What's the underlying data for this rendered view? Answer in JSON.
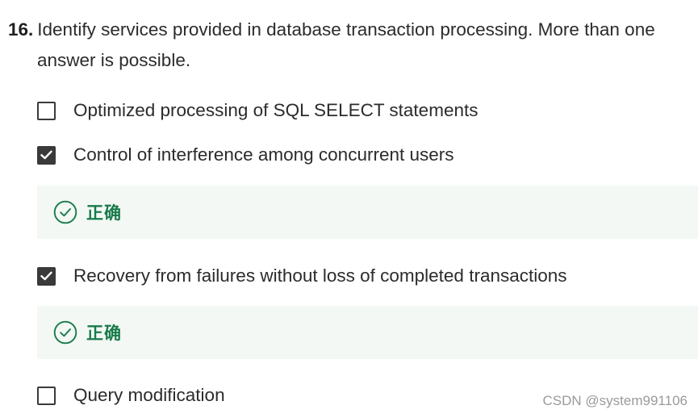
{
  "question": {
    "number": "16.",
    "text_line1": "Identify services provided in database transaction processing. More than one",
    "text_line2": "answer is possible."
  },
  "options": [
    {
      "label": "Optimized processing of SQL SELECT statements",
      "checked": false
    },
    {
      "label": "Control of interference among concurrent users",
      "checked": true,
      "feedback": "正确"
    },
    {
      "label": "Recovery from failures without loss of completed transactions",
      "checked": true,
      "feedback": "正确"
    },
    {
      "label": "Query modification",
      "checked": false
    }
  ],
  "icons": {
    "checkbox_checked": "check-icon",
    "feedback": "check-circle-icon"
  },
  "colors": {
    "correct_text": "#1a7a4a",
    "feedback_background": "#f3f8f5",
    "checkbox": "#3a3a3a"
  },
  "watermark": "CSDN @system991106"
}
